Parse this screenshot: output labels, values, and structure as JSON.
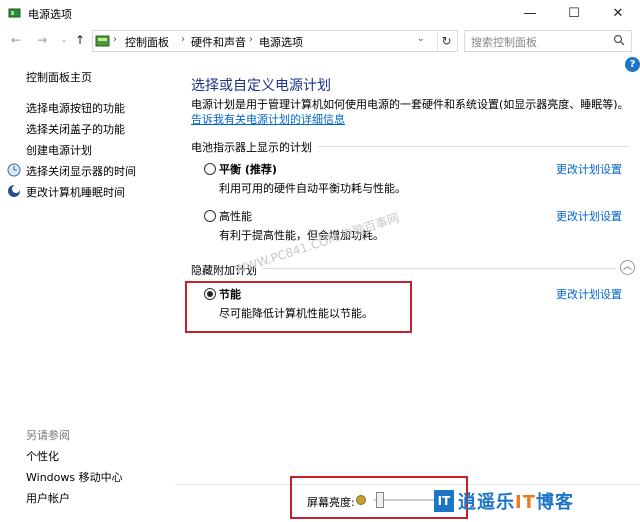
{
  "window": {
    "title": "电源选项"
  },
  "address": {
    "crumbs": [
      "控制面板",
      "硬件和声音",
      "电源选项"
    ],
    "search_placeholder": "搜索控制面板"
  },
  "sidebar": {
    "home": "控制面板主页",
    "links": [
      "选择电源按钮的功能",
      "选择关闭盖子的功能",
      "创建电源计划",
      "选择关闭显示器的时间",
      "更改计算机睡眠时间"
    ],
    "see_also_title": "另请参阅",
    "see_also": [
      "个性化",
      "Windows 移动中心",
      "用户帐户"
    ]
  },
  "main": {
    "title": "选择或自定义电源计划",
    "desc_text": "电源计划是用于管理计算机如何使用电源的一套硬件和系统设置(如显示器亮度、睡眠等)。",
    "desc_link_1": "告诉我",
    "desc_link_2": "有关电源计划的详细信息",
    "section_battery": "电池指示器上显示的计划",
    "section_hidden": "隐藏附加计划",
    "plans": [
      {
        "name": "平衡 (推荐)",
        "desc": "利用可用的硬件自动平衡功耗与性能。",
        "link": "更改计划设置",
        "selected": false
      },
      {
        "name": "高性能",
        "desc": "有利于提高性能，但会增加功耗。",
        "link": "更改计划设置",
        "selected": false
      },
      {
        "name": "节能",
        "desc": "尽可能降低计算机性能以节能。",
        "link": "更改计划设置",
        "selected": true
      }
    ],
    "help": "?"
  },
  "bottom": {
    "brightness_label": "屏幕亮度:"
  },
  "overlays": {
    "watermark": "WWW.PC841.COM 电脑百事网",
    "logo_mark": "IT",
    "logo_text_a": "逍遥乐",
    "logo_text_it": "IT",
    "logo_text_b": "博客"
  },
  "colors": {
    "link": "#0066cc",
    "title": "#1e3287",
    "highlight": "#c8202a"
  }
}
